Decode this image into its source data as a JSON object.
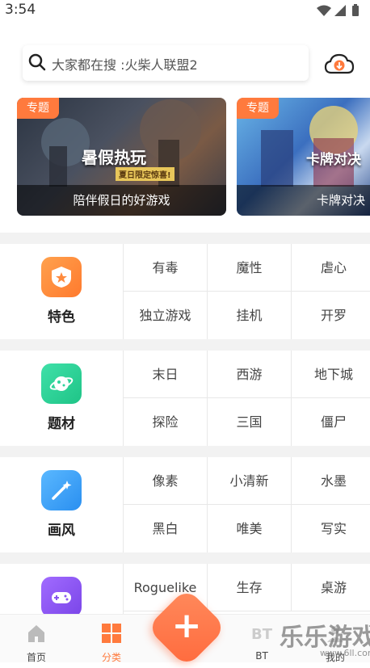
{
  "status_bar": {
    "time": "3:54"
  },
  "search": {
    "placeholder": "大家都在搜 :火柴人联盟2"
  },
  "banners": [
    {
      "tag": "专题",
      "art_title": "暑假热玩",
      "art_subtitle": "夏日限定惊喜!",
      "caption": "陪伴假日的好游戏"
    },
    {
      "tag": "专题",
      "art_title": "卡牌对决",
      "caption": "卡牌对决"
    }
  ],
  "categories": [
    {
      "name": "特色",
      "icon": "shield-star-icon",
      "color": "#ff8a3d",
      "tags": [
        "有毒",
        "魔性",
        "虐心",
        "独立游戏",
        "挂机",
        "开罗"
      ]
    },
    {
      "name": "题材",
      "icon": "planet-icon",
      "color": "#2ed39a",
      "tags": [
        "末日",
        "西游",
        "地下城",
        "探险",
        "三国",
        "僵尸"
      ]
    },
    {
      "name": "画风",
      "icon": "magic-wand-icon",
      "color": "#3aa6f5",
      "tags": [
        "像素",
        "小清新",
        "水墨",
        "黑白",
        "唯美",
        "写实"
      ]
    },
    {
      "name": "",
      "icon": "gamepad-icon",
      "color": "#8a55f0",
      "tags": [
        "Roguelike",
        "生存",
        "桌游"
      ]
    }
  ],
  "bottom_nav": {
    "items": [
      {
        "label": "首页",
        "icon": "home-icon"
      },
      {
        "label": "分类",
        "icon": "grid-icon",
        "active": true
      },
      {
        "label": "BT",
        "icon": "bt-icon"
      },
      {
        "label": "我的",
        "icon": "user-icon"
      }
    ],
    "fab_symbol": "+"
  },
  "watermark": {
    "text": "乐乐游戏",
    "url": "www.6ll.com"
  },
  "colors": {
    "accent": "#ff7a3d",
    "divider": "#f2f2f2"
  }
}
